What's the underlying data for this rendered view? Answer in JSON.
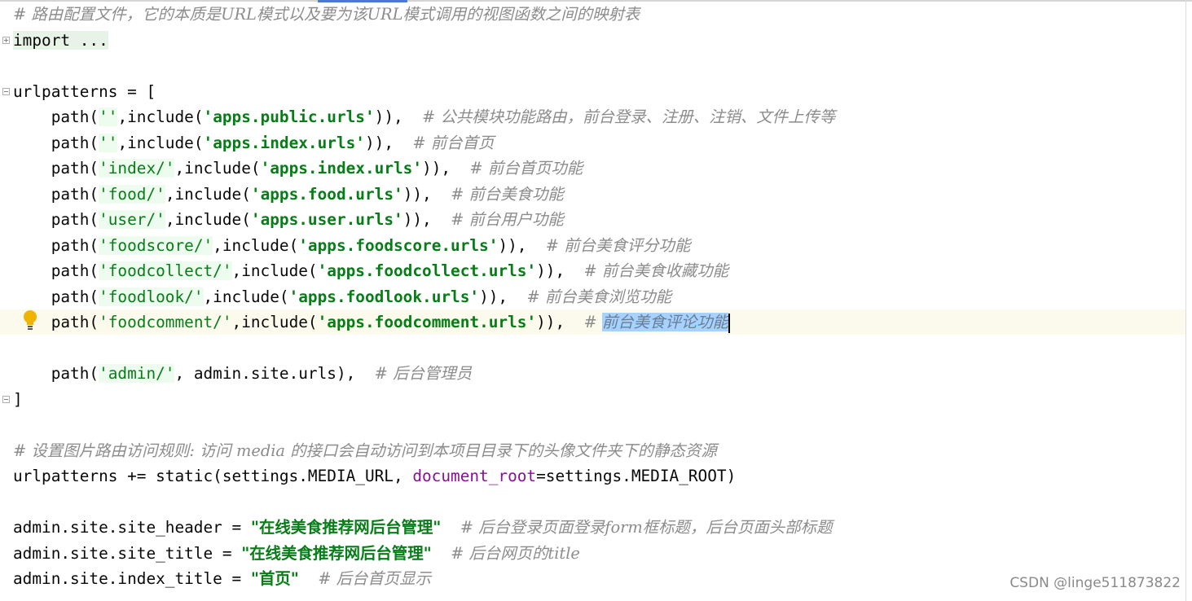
{
  "editor": {
    "lines": [
      {
        "segments": [
          {
            "t": "# 路由配置文件，它的本质是URL模式以及要为该URL模式调用的视图函数之间的映射表",
            "c": "cm"
          }
        ]
      },
      {
        "segments": [
          {
            "t": "import ...",
            "c": "fold-region"
          }
        ],
        "fold": "plus"
      },
      {
        "segments": []
      },
      {
        "segments": [
          {
            "t": "urlpatterns = [",
            "c": ""
          }
        ],
        "fold": "minus"
      },
      {
        "segments": [
          {
            "t": "    path(",
            "c": ""
          },
          {
            "t": "''",
            "c": "strq str-path"
          },
          {
            "t": ",include(",
            "c": ""
          },
          {
            "t": "'apps.public.urls'",
            "c": "str"
          },
          {
            "t": ")),  ",
            "c": ""
          },
          {
            "t": "# 公共模块功能路由，前台登录、注册、注销、文件上传等",
            "c": "cm"
          }
        ]
      },
      {
        "segments": [
          {
            "t": "    path(",
            "c": ""
          },
          {
            "t": "''",
            "c": "strq str-path"
          },
          {
            "t": ",include(",
            "c": ""
          },
          {
            "t": "'apps.index.urls'",
            "c": "str"
          },
          {
            "t": ")),  ",
            "c": ""
          },
          {
            "t": "# 前台首页",
            "c": "cm"
          }
        ]
      },
      {
        "segments": [
          {
            "t": "    path(",
            "c": ""
          },
          {
            "t": "'index/'",
            "c": "strq str-path"
          },
          {
            "t": ",include(",
            "c": ""
          },
          {
            "t": "'apps.index.urls'",
            "c": "str"
          },
          {
            "t": ")),  ",
            "c": ""
          },
          {
            "t": "# 前台首页功能",
            "c": "cm"
          }
        ]
      },
      {
        "segments": [
          {
            "t": "    path(",
            "c": ""
          },
          {
            "t": "'food/'",
            "c": "strq str-path"
          },
          {
            "t": ",include(",
            "c": ""
          },
          {
            "t": "'apps.food.urls'",
            "c": "str"
          },
          {
            "t": ")),  ",
            "c": ""
          },
          {
            "t": "# 前台美食功能",
            "c": "cm"
          }
        ]
      },
      {
        "segments": [
          {
            "t": "    path(",
            "c": ""
          },
          {
            "t": "'user/'",
            "c": "strq str-path"
          },
          {
            "t": ",include(",
            "c": ""
          },
          {
            "t": "'apps.user.urls'",
            "c": "str"
          },
          {
            "t": ")),  ",
            "c": ""
          },
          {
            "t": "# 前台用户功能",
            "c": "cm"
          }
        ]
      },
      {
        "segments": [
          {
            "t": "    path(",
            "c": ""
          },
          {
            "t": "'foodscore/'",
            "c": "strq str-path"
          },
          {
            "t": ",include(",
            "c": ""
          },
          {
            "t": "'apps.foodscore.urls'",
            "c": "str"
          },
          {
            "t": ")),  ",
            "c": ""
          },
          {
            "t": "# 前台美食评分功能",
            "c": "cm"
          }
        ]
      },
      {
        "segments": [
          {
            "t": "    path(",
            "c": ""
          },
          {
            "t": "'foodcollect/'",
            "c": "strq str-path"
          },
          {
            "t": ",include(",
            "c": ""
          },
          {
            "t": "'apps.foodcollect.urls'",
            "c": "str"
          },
          {
            "t": ")),  ",
            "c": ""
          },
          {
            "t": "# 前台美食收藏功能",
            "c": "cm"
          }
        ]
      },
      {
        "segments": [
          {
            "t": "    path(",
            "c": ""
          },
          {
            "t": "'foodlook/'",
            "c": "strq str-path"
          },
          {
            "t": ",include(",
            "c": ""
          },
          {
            "t": "'apps.foodlook.urls'",
            "c": "str"
          },
          {
            "t": ")),  ",
            "c": ""
          },
          {
            "t": "# 前台美食浏览功能",
            "c": "cm"
          }
        ]
      },
      {
        "segments": [
          {
            "t": "    path(",
            "c": ""
          },
          {
            "t": "'foodcomment/'",
            "c": "strq"
          },
          {
            "t": ",include(",
            "c": ""
          },
          {
            "t": "'apps.foodcomment.urls'",
            "c": "str"
          },
          {
            "t": ")),  ",
            "c": ""
          },
          {
            "t": "# ",
            "c": "cm"
          },
          {
            "t": "前台美食评论功能",
            "c": "cm sel"
          }
        ],
        "caret": true
      },
      {
        "segments": []
      },
      {
        "segments": [
          {
            "t": "    path(",
            "c": ""
          },
          {
            "t": "'admin/'",
            "c": "strq str-path"
          },
          {
            "t": ", admin.site.urls),  ",
            "c": ""
          },
          {
            "t": "# 后台管理员",
            "c": "cm"
          }
        ]
      },
      {
        "segments": [
          {
            "t": "]",
            "c": ""
          }
        ],
        "fold": "minus"
      },
      {
        "segments": []
      },
      {
        "segments": [
          {
            "t": "# 设置图片路由访问规则: 访问 media 的接口会自动访问到本项目目录下的头像文件夹下的静态资源",
            "c": "cm"
          }
        ]
      },
      {
        "segments": [
          {
            "t": "urlpatterns += static(settings.MEDIA_URL, ",
            "c": ""
          },
          {
            "t": "document_root",
            "c": "param"
          },
          {
            "t": "=settings.MEDIA_ROOT)",
            "c": ""
          }
        ]
      },
      {
        "segments": []
      },
      {
        "segments": [
          {
            "t": "admin.site.site_header = ",
            "c": ""
          },
          {
            "t": "\"在线美食推荐网后台管理\"",
            "c": "dstr"
          },
          {
            "t": "  ",
            "c": ""
          },
          {
            "t": "# 后台登录页面登录form框标题，后台页面头部标题",
            "c": "cm"
          }
        ]
      },
      {
        "segments": [
          {
            "t": "admin.site.site_title = ",
            "c": ""
          },
          {
            "t": "\"在线美食推荐网后台管理\"",
            "c": "dstr"
          },
          {
            "t": "  ",
            "c": ""
          },
          {
            "t": "# 后台网页的title",
            "c": "cm"
          }
        ]
      },
      {
        "segments": [
          {
            "t": "admin.site.index_title = ",
            "c": ""
          },
          {
            "t": "\"首页\"",
            "c": "dstr"
          },
          {
            "t": "  ",
            "c": ""
          },
          {
            "t": "# 后台首页显示",
            "c": "cm"
          }
        ]
      }
    ]
  },
  "watermark": "CSDN @linge511873822",
  "colors": {
    "comment": "#8c8c8c",
    "string": "#067d17",
    "keyword_arg": "#871094",
    "selection": "#a6d2ff",
    "current_line": "#fcfaed"
  },
  "icons": {
    "intention": "lightbulb-icon",
    "fold": "fold-marker-icon"
  }
}
